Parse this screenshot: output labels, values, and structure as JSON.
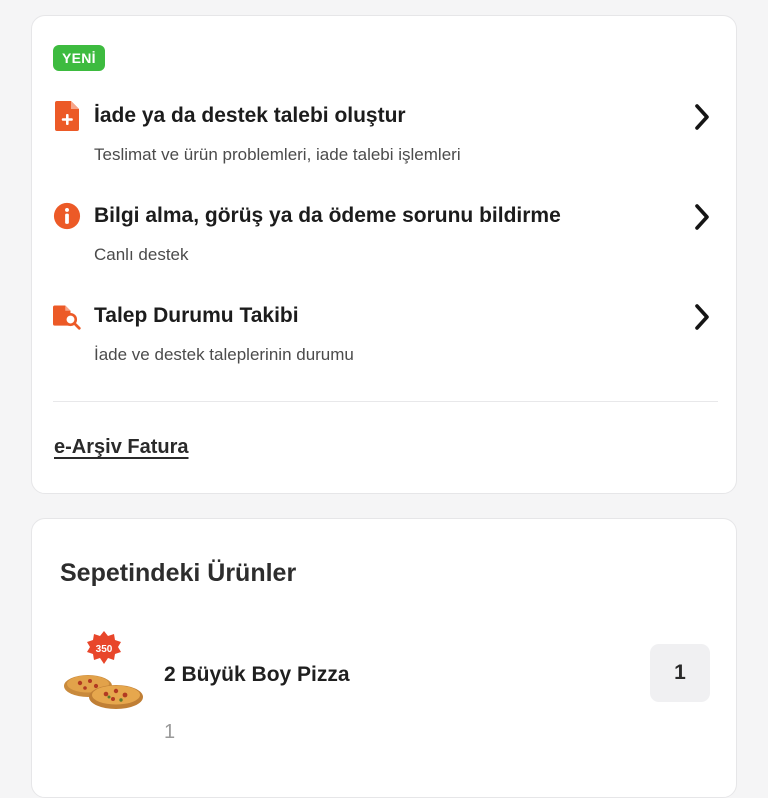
{
  "support": {
    "badge": "YENİ",
    "options": [
      {
        "title": "İade ya da destek talebi oluştur",
        "subtitle": "Teslimat ve ürün problemleri, iade talebi işlemleri",
        "icon": "document-plus-icon"
      },
      {
        "title": "Bilgi alma, görüş ya da ödeme sorunu bildirme",
        "subtitle": "Canlı destek",
        "icon": "info-icon"
      },
      {
        "title": "Talep Durumu Takibi",
        "subtitle": "İade ve destek taleplerinin durumu",
        "icon": "document-search-icon"
      }
    ],
    "archive_link": "e-Arşiv Fatura"
  },
  "cart": {
    "title": "Sepetindeki Ürünler",
    "items": [
      {
        "name": "2 Büyük Boy Pizza",
        "quantity_note": "1",
        "quantity": "1",
        "image_badge": "350"
      }
    ]
  },
  "colors": {
    "accent": "#ec5a27",
    "badge_green": "#3dbb3f",
    "background": "#f5f5f6",
    "card": "#ffffff"
  }
}
